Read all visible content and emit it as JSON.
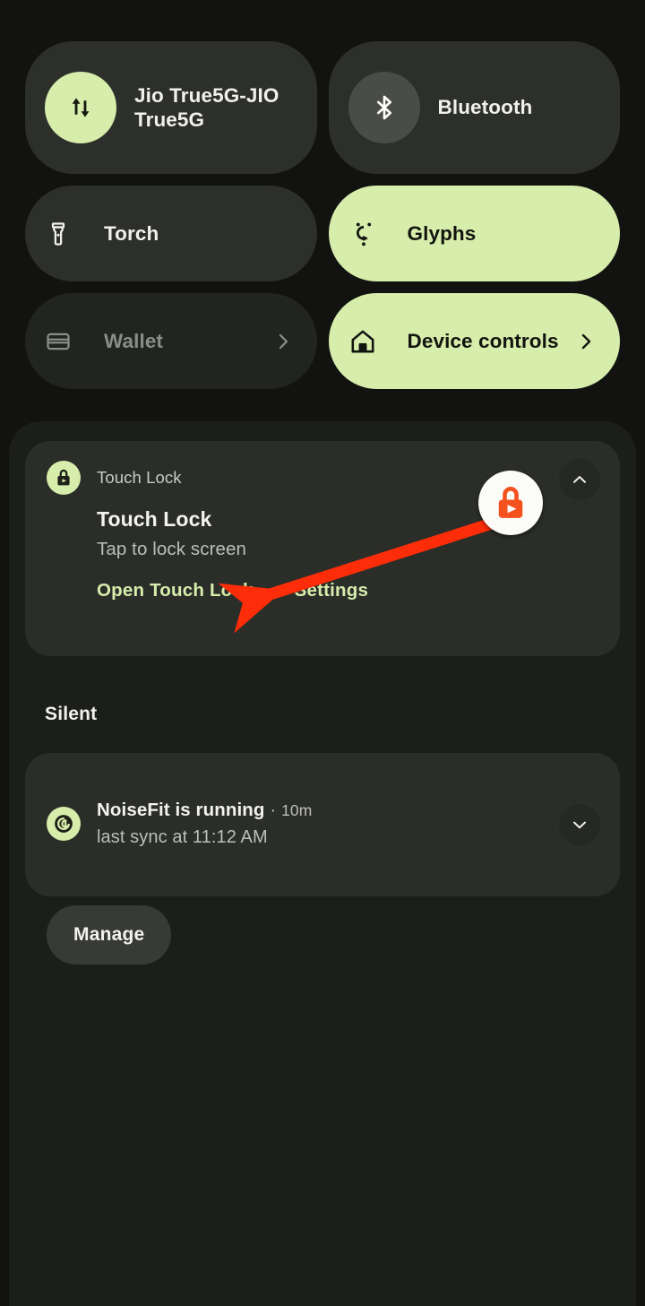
{
  "theme": {
    "page_bg": "#121311",
    "shade_bg": "#1c1e1a",
    "tile_bg": "#2d2f2b",
    "tile_bg_dim": "#222420",
    "accent_green": "#d7edab",
    "card_bg": "#2b2d29",
    "text_primary": "#f2f3ee",
    "text_secondary": "#bcbeb8",
    "annotation_red": "#fc2d08",
    "badge_orange": "#f4511e"
  },
  "quick_settings": {
    "tiles": [
      {
        "id": "internet",
        "label": "Jio True5G-JIO True5G",
        "icon": "data-transfer-icon",
        "state": "on",
        "style": "icon-circle-green",
        "chevron": false
      },
      {
        "id": "bluetooth",
        "label": "Bluetooth",
        "icon": "bluetooth-icon",
        "state": "off",
        "style": "icon-circle-grey",
        "chevron": false
      },
      {
        "id": "torch",
        "label": "Torch",
        "icon": "flashlight-icon",
        "state": "off",
        "style": "icon-plain",
        "chevron": false
      },
      {
        "id": "glyphs",
        "label": "Glyphs",
        "icon": "glyph-face-icon",
        "state": "on",
        "style": "icon-plain",
        "chevron": false
      },
      {
        "id": "wallet",
        "label": "Wallet",
        "icon": "wallet-card-icon",
        "state": "unavailable",
        "style": "icon-plain",
        "chevron": true
      },
      {
        "id": "device-controls",
        "label": "Device controls",
        "icon": "home-icon",
        "state": "on",
        "style": "icon-plain",
        "chevron": true
      }
    ]
  },
  "notifications": {
    "touch_lock": {
      "app_name": "Touch Lock",
      "app_icon": "lock-play-icon",
      "title": "Touch Lock",
      "text": "Tap to lock screen",
      "actions": [
        {
          "id": "open-touch-lock",
          "label": "Open Touch Lock"
        },
        {
          "id": "settings",
          "label": "Settings"
        }
      ],
      "expand_state": "collapse-chevron-up-icon"
    },
    "silent_section_label": "Silent",
    "noisefit": {
      "app_name": "NoiseFit",
      "app_icon": "noisefit-spiral-icon",
      "title": "NoiseFit is running",
      "separator": "·",
      "time": "10m",
      "text": "last sync at 11:12 AM",
      "expand_state": "expand-chevron-down-icon"
    },
    "manage_label": "Manage"
  },
  "annotation": {
    "badge_icon": "lock-play-highlight-icon",
    "arrow": "red-arrow-pointing-to-open-touch-lock"
  }
}
